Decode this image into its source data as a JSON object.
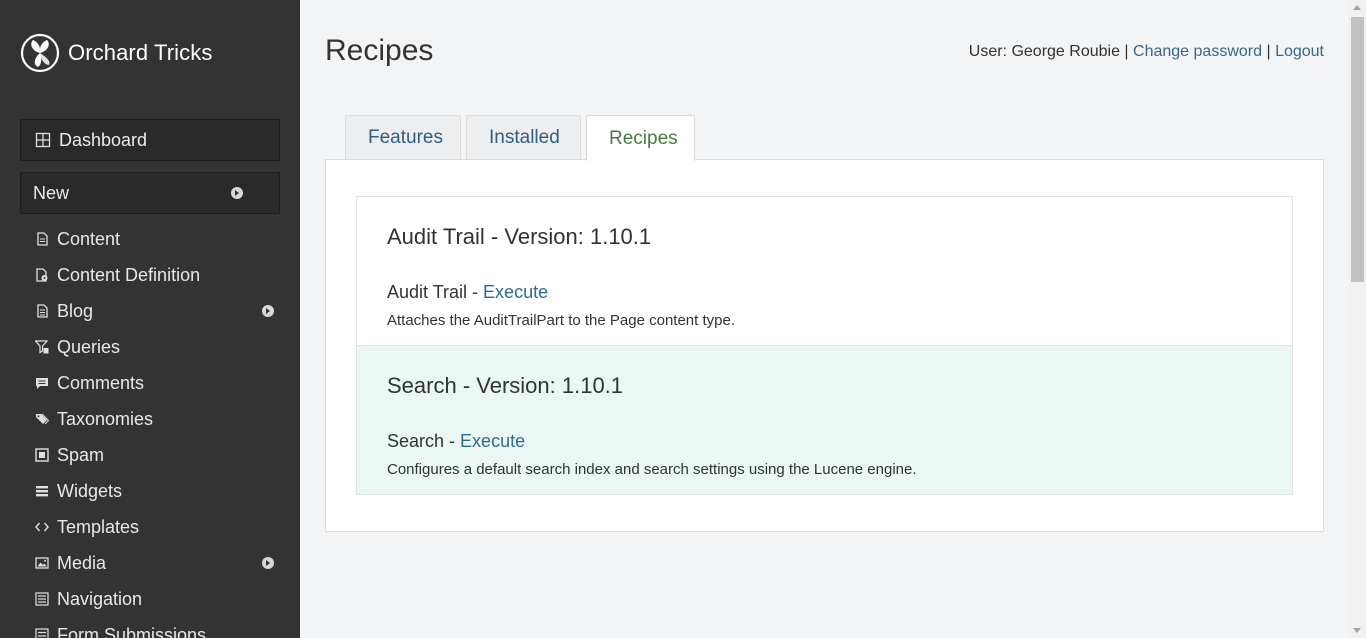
{
  "brand": {
    "name": "Orchard Tricks"
  },
  "sidebar": {
    "dashboard": {
      "label": "Dashboard",
      "icon": "dashboard-icon"
    },
    "new": {
      "label": "New"
    },
    "items": [
      {
        "label": "Content",
        "icon": "content-icon",
        "has_submenu": false
      },
      {
        "label": "Content Definition",
        "icon": "content-definition-icon",
        "has_submenu": false
      },
      {
        "label": "Blog",
        "icon": "blog-icon",
        "has_submenu": true
      },
      {
        "label": "Queries",
        "icon": "queries-icon",
        "has_submenu": false
      },
      {
        "label": "Comments",
        "icon": "comments-icon",
        "has_submenu": false
      },
      {
        "label": "Taxonomies",
        "icon": "tags-icon",
        "has_submenu": false
      },
      {
        "label": "Spam",
        "icon": "spam-icon",
        "has_submenu": false
      },
      {
        "label": "Widgets",
        "icon": "widgets-icon",
        "has_submenu": false
      },
      {
        "label": "Templates",
        "icon": "templates-icon",
        "has_submenu": false
      },
      {
        "label": "Media",
        "icon": "media-icon",
        "has_submenu": true
      },
      {
        "label": "Navigation",
        "icon": "navigation-icon",
        "has_submenu": false
      },
      {
        "label": "Form Submissions",
        "icon": "form-icon",
        "has_submenu": false
      }
    ]
  },
  "header": {
    "title": "Recipes",
    "user_prefix": "User: George Roubie",
    "separator": "|",
    "change_password": "Change password",
    "logout": "Logout"
  },
  "tabs": [
    {
      "label": "Features",
      "active": false
    },
    {
      "label": "Installed",
      "active": false
    },
    {
      "label": "Recipes",
      "active": true
    }
  ],
  "recipes": [
    {
      "title": "Audit Trail - Version: 1.10.1",
      "name": "Audit Trail",
      "dash": " - ",
      "action": "Execute",
      "description": "Attaches the AuditTrailPart to the Page content type."
    },
    {
      "title": "Search - Version: 1.10.1",
      "name": "Search",
      "dash": " - ",
      "action": "Execute",
      "description": "Configures a default search index and search settings using the Lucene engine."
    }
  ],
  "colors": {
    "sidebar_bg": "#333333",
    "link": "#2f6b8f",
    "active_tab_text": "#4a7a45",
    "highlight_row": "#eaf7f2"
  }
}
